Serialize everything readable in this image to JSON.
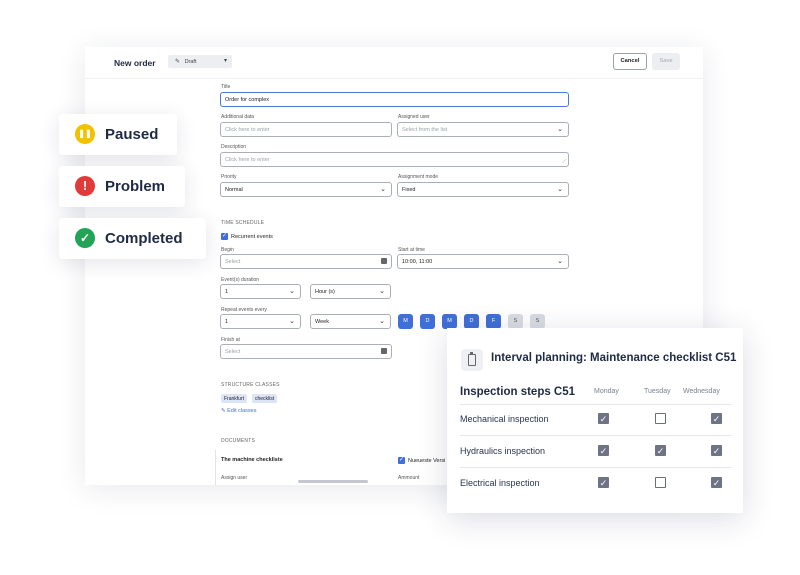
{
  "form": {
    "title": "New order",
    "status": "Draft",
    "cancel_label": "Cancel",
    "save_label": "Save",
    "title_label": "Title",
    "title_value": "Order for complex",
    "additional_data_label": "Additional data",
    "additional_data_placeholder": "Click here to enter",
    "assigned_user_label": "Assigned user",
    "assigned_user_placeholder": "Select from the list",
    "description_label": "Description",
    "description_placeholder": "Click here to enter",
    "priority_label": "Priority",
    "priority_value": "Normal",
    "assignment_mode_label": "Assignment mode",
    "assignment_mode_value": "Fixed",
    "time_schedule_heading": "TIME SCHEDULE",
    "recurrent_label": "Recurrent events",
    "begin_label": "Begin",
    "begin_placeholder": "Select",
    "start_time_label": "Start at time",
    "start_time_value": "10:00, 11:00",
    "duration_label": "Event(s) duration",
    "duration_value": "1",
    "duration_unit": "Hour (s)",
    "repeat_label": "Repeat events every",
    "repeat_value": "1",
    "repeat_unit": "Week",
    "days": [
      {
        "label": "M",
        "active": true
      },
      {
        "label": "D",
        "active": true
      },
      {
        "label": "M",
        "active": true
      },
      {
        "label": "D",
        "active": true
      },
      {
        "label": "F",
        "active": true
      },
      {
        "label": "S",
        "active": false
      },
      {
        "label": "S",
        "active": false
      }
    ],
    "finish_label": "Finish at",
    "finish_placeholder": "Select",
    "structure_heading": "STRUCTURE CLASSES",
    "tags": [
      "Frankfurt",
      "checklist"
    ],
    "edit_classes_label": "Edit classes",
    "documents_heading": "DOCUMENTS",
    "doc_title": "The machine checkliste",
    "doc_checkbox_label": "Nueueste Versi",
    "assign_user_label": "Assign user",
    "amount_label": "Ammount"
  },
  "status_cards": [
    {
      "label": "Paused",
      "icon": "pause-icon",
      "color": "#f2c200",
      "glyph": "❚❚"
    },
    {
      "label": "Problem",
      "icon": "alert-icon",
      "color": "#e03a3a",
      "glyph": "!"
    },
    {
      "label": "Completed",
      "icon": "check-icon",
      "color": "#22a356",
      "glyph": "✓"
    }
  ],
  "planning": {
    "title": "Interval planning: Maintenance checklist C51",
    "steps_title": "Inspection steps C51",
    "columns": [
      "Monday",
      "Tuesday",
      "Wednesday"
    ],
    "rows": [
      {
        "label": "Mechanical inspection",
        "checks": [
          true,
          false,
          true
        ]
      },
      {
        "label": "Hydraulics inspection",
        "checks": [
          true,
          true,
          true
        ]
      },
      {
        "label": "Electrical inspection",
        "checks": [
          true,
          false,
          true
        ]
      }
    ]
  },
  "colors": {
    "accent": "#3f6fd8",
    "paused": "#f2c200",
    "problem": "#e03a3a",
    "completed": "#22a356"
  }
}
